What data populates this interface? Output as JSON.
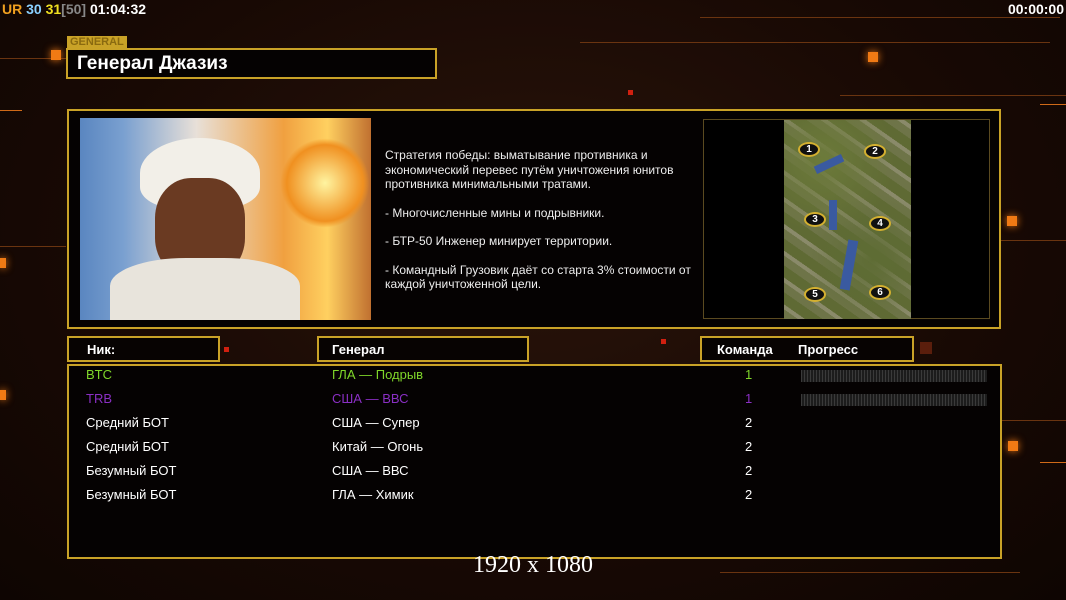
{
  "hud": {
    "left_ur": "UR",
    "left_a": "30",
    "left_b": "31",
    "left_c": "[50]",
    "left_time": "01:04:32",
    "right_time": "00:00:00"
  },
  "general": {
    "tag": "GENERAL",
    "name": "Генерал Джазиз",
    "description": [
      "Стратегия победы: выматывание противника и экономический перевес путём уничтожения юнитов противника минимальными тратами.",
      "- Многочисленные мины и подрывники.",
      "- БТР-50 Инженер минирует территории.",
      "- Командный Грузовик даёт со старта 3% стоимости от каждой уничтоженной цели."
    ]
  },
  "map": {
    "slots": [
      "1",
      "2",
      "3",
      "4",
      "5",
      "6"
    ]
  },
  "table": {
    "headers": {
      "nick": "Ник:",
      "general": "Генерал",
      "team": "Команда",
      "progress": "Прогресс"
    },
    "rows": [
      {
        "nick": "BTC",
        "general": "ГЛА — Подрыв",
        "team": "1",
        "color": "#7fd62a",
        "progress": 0
      },
      {
        "nick": "TRB",
        "general": "США — ВВС",
        "team": "1",
        "color": "#8a2fc4",
        "progress": 0
      },
      {
        "nick": "Средний БОТ",
        "general": "США — Супер",
        "team": "2",
        "color": "#ffffff"
      },
      {
        "nick": "Средний БОТ",
        "general": "Китай — Огонь",
        "team": "2",
        "color": "#ffffff"
      },
      {
        "nick": "Безумный БОТ",
        "general": "США — ВВС",
        "team": "2",
        "color": "#ffffff"
      },
      {
        "nick": "Безумный БОТ",
        "general": "ГЛА — Химик",
        "team": "2",
        "color": "#ffffff"
      }
    ]
  },
  "resolution": "1920 x 1080"
}
